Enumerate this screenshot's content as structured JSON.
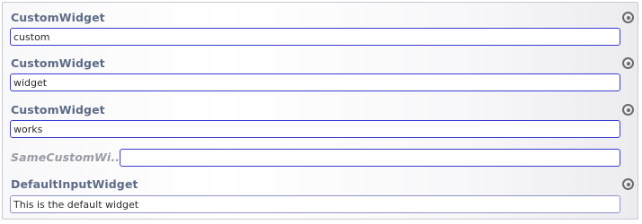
{
  "rows": [
    {
      "label": "CustomWidget",
      "value": "custom"
    },
    {
      "label": "CustomWidget",
      "value": "widget"
    },
    {
      "label": "CustomWidget",
      "value": "works"
    },
    {
      "label": "SameCustomWi...",
      "value": ""
    },
    {
      "label": "DefaultInputWidget",
      "value": "This is the default widget"
    }
  ],
  "icons": {
    "row_action": "radio-target-icon"
  }
}
